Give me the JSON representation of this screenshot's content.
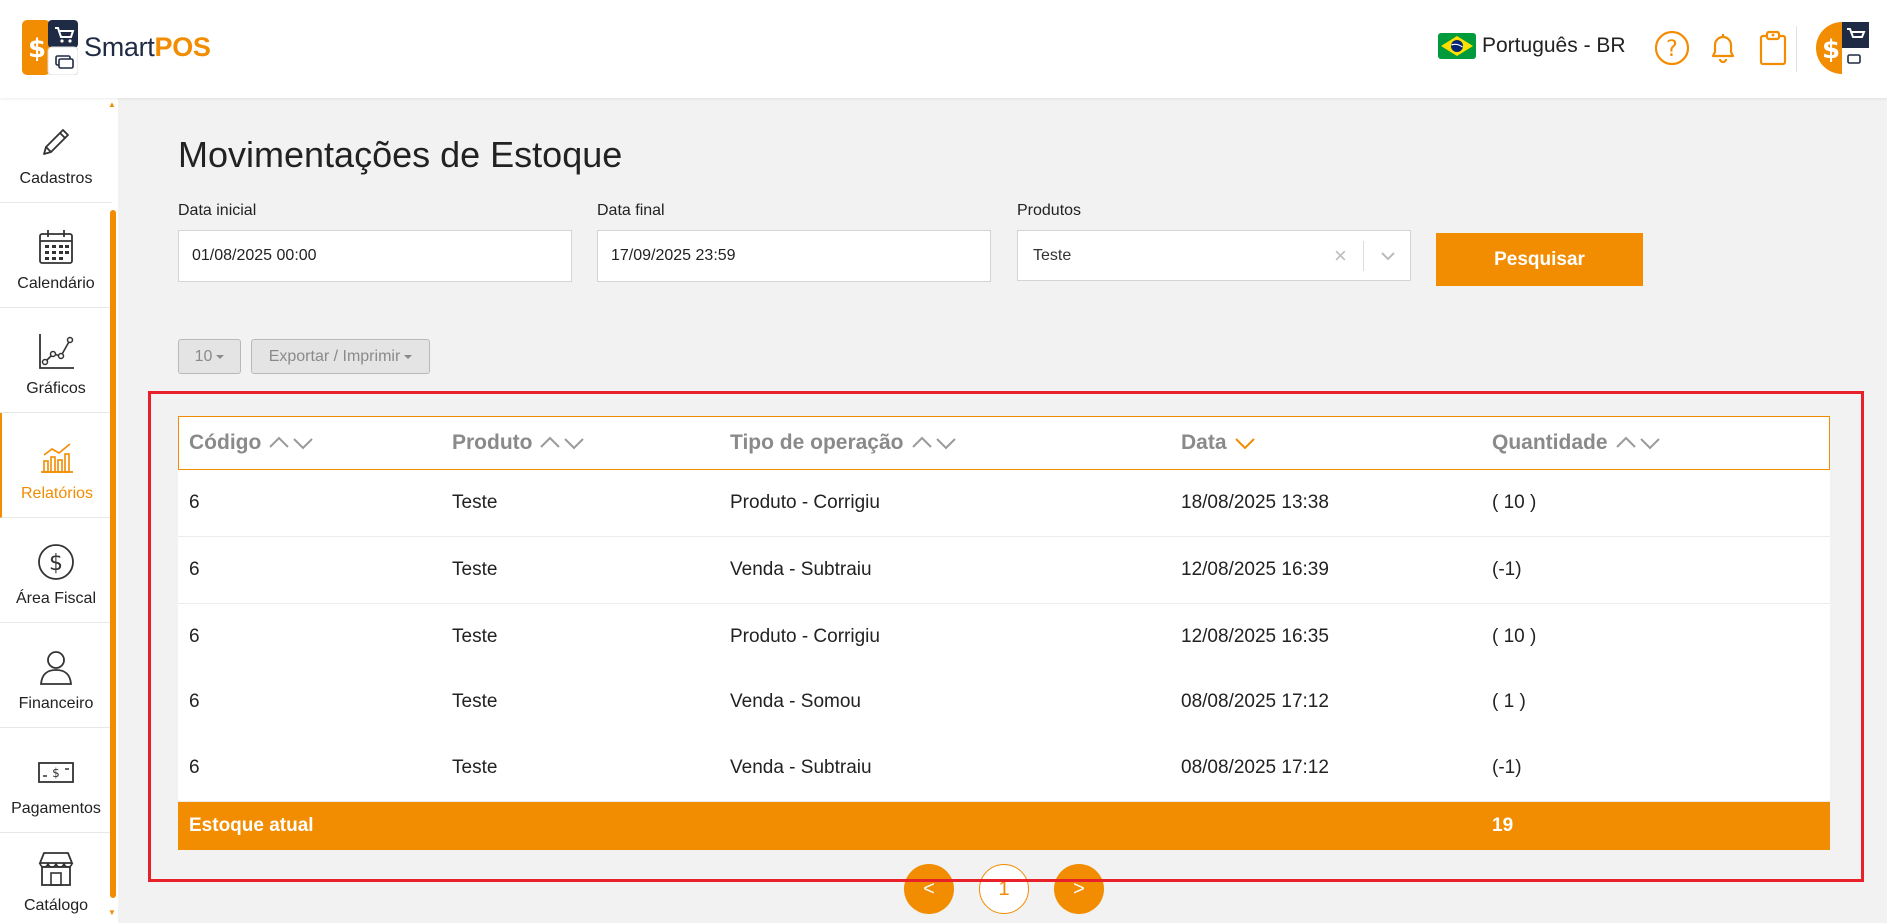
{
  "app": {
    "brand_main": "Smart",
    "brand_accent": "POS",
    "accent_color": "#f28c00",
    "dark_color": "#1f2a44"
  },
  "header": {
    "language": "Português - BR",
    "icons": [
      "help-icon",
      "bell-icon",
      "clipboard-icon"
    ]
  },
  "sidebar": {
    "items": [
      {
        "label": "Cadastros",
        "icon": "pencil-icon"
      },
      {
        "label": "Calendário",
        "icon": "calendar-icon"
      },
      {
        "label": "Gráficos",
        "icon": "line-chart-icon"
      },
      {
        "label": "Relatórios",
        "icon": "bar-chart-icon",
        "active": true
      },
      {
        "label": "Área Fiscal",
        "icon": "dollar-circle-icon"
      },
      {
        "label": "Financeiro",
        "icon": "person-icon"
      },
      {
        "label": "Pagamentos",
        "icon": "banknote-icon"
      },
      {
        "label": "Catálogo",
        "icon": "store-icon"
      }
    ]
  },
  "page": {
    "title": "Movimentações de Estoque"
  },
  "filters": {
    "start_label": "Data inicial",
    "start_value": "01/08/2025 00:00",
    "end_label": "Data final",
    "end_value": "17/09/2025 23:59",
    "products_label": "Produtos",
    "products_value": "Teste",
    "search_button": "Pesquisar"
  },
  "toolbar": {
    "page_size": "10",
    "export_label": "Exportar / Imprimir"
  },
  "table": {
    "headers": [
      "Código",
      "Produto",
      "Tipo de operação",
      "Data",
      "Quantidade"
    ],
    "rows": [
      [
        "6",
        "Teste",
        "Produto - Corrigiu",
        "18/08/2025 13:38",
        "( 10 )"
      ],
      [
        "6",
        "Teste",
        "Venda - Subtraiu",
        "12/08/2025 16:39",
        "(-1)"
      ],
      [
        "6",
        "Teste",
        "Produto - Corrigiu",
        "12/08/2025 16:35",
        "( 10 )"
      ],
      [
        "6",
        "Teste",
        "Venda - Somou",
        "08/08/2025 17:12",
        "( 1 )"
      ],
      [
        "6",
        "Teste",
        "Venda - Subtraiu",
        "08/08/2025 17:12",
        "(-1)"
      ]
    ],
    "footer_label": "Estoque atual",
    "footer_value": "19"
  },
  "pagination": {
    "prev": "<",
    "current": "1",
    "next": ">"
  }
}
